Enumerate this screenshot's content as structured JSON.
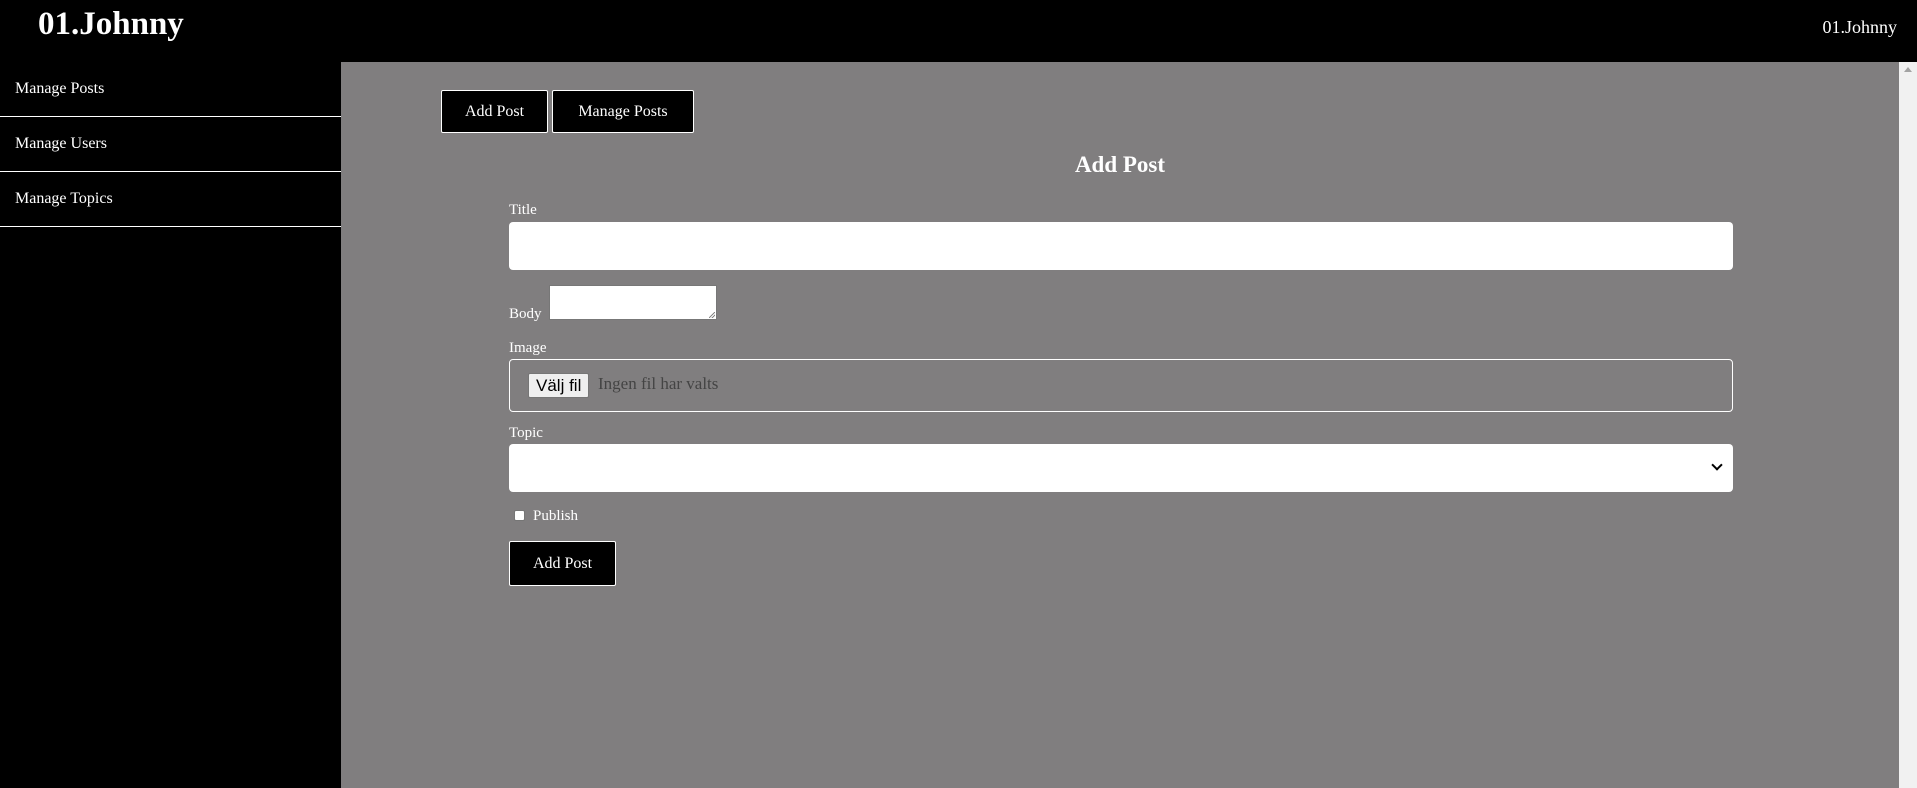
{
  "header": {
    "brand": "01.Johnny",
    "user": "01.Johnny"
  },
  "sidebar": {
    "items": [
      {
        "label": "Manage Posts"
      },
      {
        "label": "Manage Users"
      },
      {
        "label": "Manage Topics"
      }
    ]
  },
  "tabs": {
    "add_post": "Add Post",
    "manage_posts": "Manage Posts"
  },
  "form": {
    "heading": "Add Post",
    "title_label": "Title",
    "title_value": "",
    "body_label": "Body",
    "body_value": "",
    "image_label": "Image",
    "file_button": "Välj fil",
    "file_status": "Ingen fil har valts",
    "topic_label": "Topic",
    "topic_selected": "",
    "publish_label": "Publish",
    "publish_checked": false,
    "submit_label": "Add Post"
  },
  "colors": {
    "background": "#000000",
    "main_panel": "#807e7f",
    "text": "#ffffff"
  }
}
